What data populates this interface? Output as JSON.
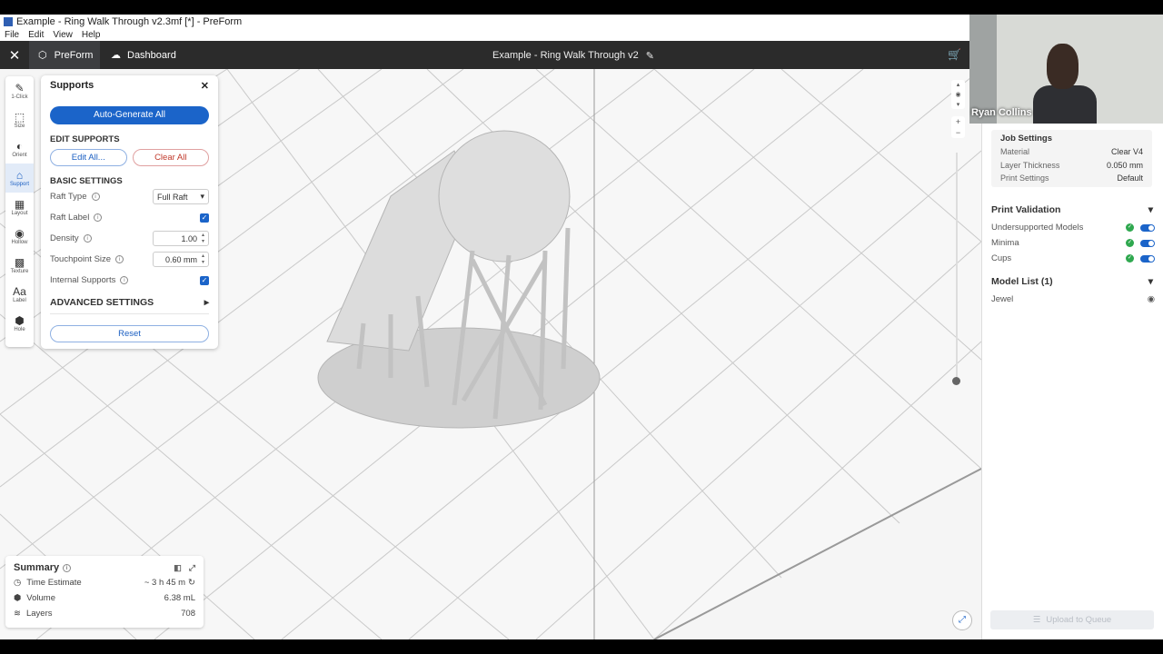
{
  "window": {
    "title": "Example - Ring Walk Through v2.3mf [*] - PreForm"
  },
  "menu": [
    "File",
    "Edit",
    "View",
    "Help"
  ],
  "header": {
    "tab_preform": "PreForm",
    "tab_dashboard": "Dashboard",
    "doc_title": "Example - Ring Walk Through v2"
  },
  "toolbar": {
    "items": [
      {
        "label": "1-Click",
        "icon": "✎"
      },
      {
        "label": "Size",
        "icon": "⬚"
      },
      {
        "label": "Orient",
        "icon": "◐"
      },
      {
        "label": "Support",
        "icon": "⌂"
      },
      {
        "label": "Layout",
        "icon": "▦"
      },
      {
        "label": "Hollow",
        "icon": "◉"
      },
      {
        "label": "Texture",
        "icon": "▩"
      },
      {
        "label": "Label",
        "icon": "Aa"
      },
      {
        "label": "Hole",
        "icon": "⬢"
      }
    ]
  },
  "supports": {
    "title": "Supports",
    "auto_generate": "Auto-Generate All",
    "edit_section": "EDIT SUPPORTS",
    "edit_all": "Edit All...",
    "clear_all": "Clear All",
    "basic_section": "BASIC SETTINGS",
    "raft_type_label": "Raft Type",
    "raft_type_value": "Full Raft",
    "raft_label_label": "Raft Label",
    "density_label": "Density",
    "density_value": "1.00",
    "touchpoint_label": "Touchpoint Size",
    "touchpoint_value": "0.60 mm",
    "internal_label": "Internal Supports",
    "advanced": "ADVANCED SETTINGS",
    "reset": "Reset"
  },
  "summary": {
    "title": "Summary",
    "time_label": "Time Estimate",
    "time_value": "~ 3 h 45 m",
    "volume_label": "Volume",
    "volume_value": "6.38 mL",
    "layers_label": "Layers",
    "layers_value": "708"
  },
  "webcam": {
    "name": "Ryan Collins"
  },
  "job": {
    "title": "Job Settings",
    "material_label": "Material",
    "material_value": "Clear V4",
    "layer_label": "Layer Thickness",
    "layer_value": "0.050 mm",
    "print_label": "Print Settings",
    "print_value": "Default"
  },
  "validation": {
    "title": "Print Validation",
    "items": [
      "Undersupported Models",
      "Minima",
      "Cups"
    ]
  },
  "model_list": {
    "title": "Model List (1)",
    "items": [
      "Jewel"
    ]
  },
  "upload": "Upload to Queue",
  "colors": {
    "accent": "#1b64c9",
    "header": "#2b2b2b",
    "ok": "#2fa84f"
  }
}
